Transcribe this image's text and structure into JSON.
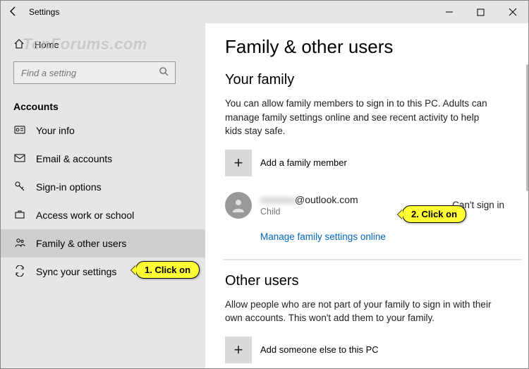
{
  "titlebar": {
    "title": "Settings"
  },
  "watermark": "TenForums.com",
  "sidebar": {
    "home": "Home",
    "search_placeholder": "Find a setting",
    "category": "Accounts",
    "items": [
      {
        "label": "Your info"
      },
      {
        "label": "Email & accounts"
      },
      {
        "label": "Sign-in options"
      },
      {
        "label": "Access work or school"
      },
      {
        "label": "Family & other users"
      },
      {
        "label": "Sync your settings"
      }
    ]
  },
  "main": {
    "heading": "Family & other users",
    "family": {
      "title": "Your family",
      "desc": "You can allow family members to sign in to this PC. Adults can manage family settings online and see recent activity to help kids stay safe.",
      "add_label": "Add a family member",
      "member": {
        "email_visible": "@outlook.com",
        "role": "Child",
        "status": "Can't sign in"
      },
      "manage_link": "Manage family settings online"
    },
    "other": {
      "title": "Other users",
      "desc": "Allow people who are not part of your family to sign in with their own accounts. This won't add them to your family.",
      "add_label": "Add someone else to this PC"
    }
  },
  "callouts": {
    "c1": "1. Click on",
    "c2": "2. Click on"
  }
}
